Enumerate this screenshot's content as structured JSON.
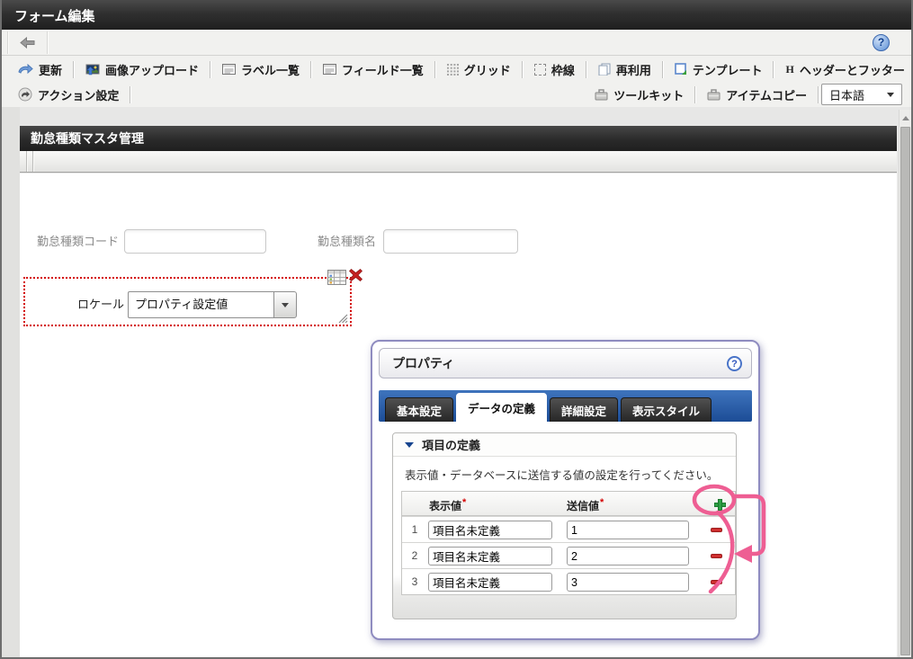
{
  "colors": {
    "tab_bar_blue": "#2a5fa8",
    "selection_red": "#d40000",
    "annotation_pink": "#ee5e93",
    "plus_green": "#2da044",
    "minus_red": "#cf2f2f",
    "title_bar_dark": "#2b2b2b"
  },
  "titlebar": {
    "title": "フォーム編集"
  },
  "toolbar": {
    "row1": [
      {
        "label": "更新"
      },
      {
        "label": "画像アップロード"
      },
      {
        "label": "ラベル一覧"
      },
      {
        "label": "フィールド一覧"
      },
      {
        "label": "グリッド"
      },
      {
        "label": "枠線"
      },
      {
        "label": "再利用"
      },
      {
        "label": "テンプレート"
      },
      {
        "label": "ヘッダーとフッター",
        "icon_letter": "H"
      }
    ],
    "action_settings": "アクション設定",
    "toolkit": "ツールキット",
    "item_copy": "アイテムコピー",
    "language": {
      "value": "日本語"
    },
    "help": "?"
  },
  "form": {
    "section_title": "勤怠種類マスタ管理",
    "code_field": {
      "label": "勤怠種類コード",
      "value": ""
    },
    "name_field": {
      "label": "勤怠種類名",
      "value": ""
    },
    "locale": {
      "label": "ロケール",
      "value": "プロパティ設定値"
    }
  },
  "dialog": {
    "title": "プロパティ",
    "help": "?",
    "tabs": [
      {
        "label": "基本設定"
      },
      {
        "label": "データの定義"
      },
      {
        "label": "詳細設定"
      },
      {
        "label": "表示スタイル"
      }
    ],
    "active_tab": "データの定義",
    "section_title": "項目の定義",
    "instruction": "表示値・データベースに送信する値の設定を行ってください。",
    "table": {
      "col_display": "表示値",
      "col_send": "送信値",
      "required_mark": "*",
      "rows": [
        {
          "index": "1",
          "display_value": "項目名未定義",
          "send_value": "1"
        },
        {
          "index": "2",
          "display_value": "項目名未定義",
          "send_value": "2"
        },
        {
          "index": "3",
          "display_value": "項目名未定義",
          "send_value": "3"
        }
      ]
    }
  }
}
